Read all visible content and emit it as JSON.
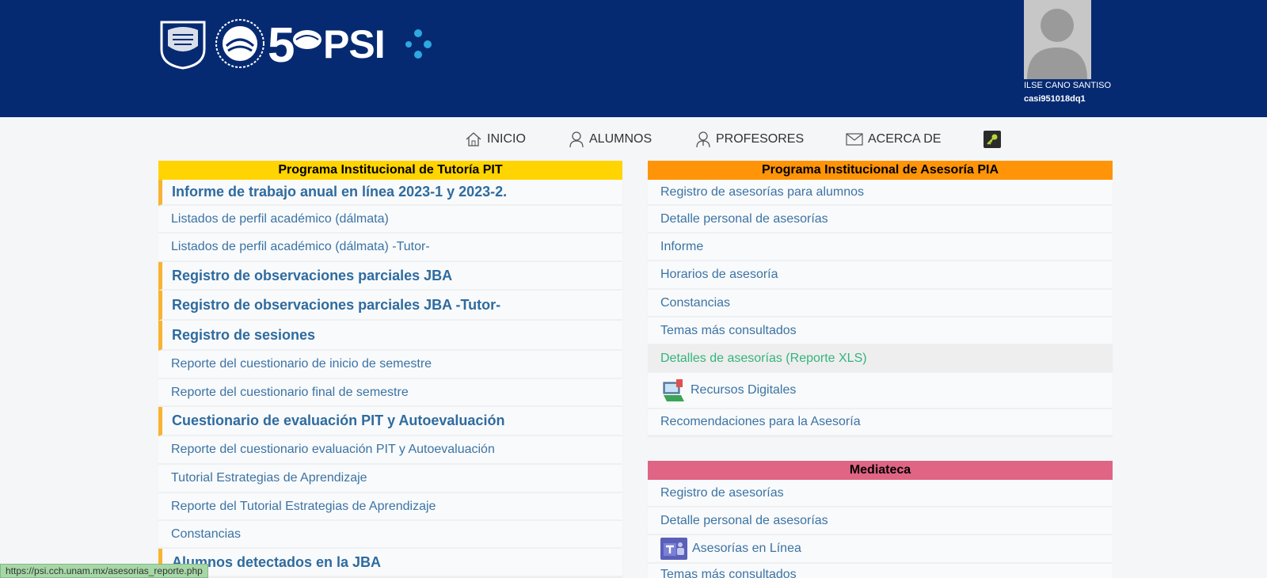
{
  "header": {
    "logo_text": "PSI",
    "user_name": "ILSE CANO SANTISO",
    "user_id": "casi951018dq1"
  },
  "nav": [
    {
      "label": "INICIO",
      "icon": "home-icon"
    },
    {
      "label": "ALUMNOS",
      "icon": "student-icon"
    },
    {
      "label": "PROFESORES",
      "icon": "teacher-icon"
    },
    {
      "label": "ACERCA DE",
      "icon": "envelope-icon"
    }
  ],
  "pit": {
    "title": "Programa Institucional de Tutoría PIT",
    "items": [
      "Informe de trabajo anual en línea 2023-1 y 2023-2.",
      "Listados de perfil académico (dálmata)",
      "Listados de perfil académico (dálmata) -Tutor-",
      "Registro de observaciones parciales JBA",
      "Registro de observaciones parciales JBA -Tutor-",
      "Registro de sesiones",
      "Reporte del cuestionario de inicio de semestre",
      "Reporte del cuestionario final de semestre",
      "Cuestionario de evaluación PIT y Autoevaluación",
      "Reporte del cuestionario evaluación PIT y Autoevaluación",
      "Tutorial Estrategias de Aprendizaje",
      "Reporte del Tutorial Estrategias de Aprendizaje",
      "Constancias",
      "Alumnos detectados en la JBA"
    ]
  },
  "pia": {
    "title": "Programa Institucional de Asesoría PIA",
    "items": [
      "Registro de asesorías para alumnos",
      "Detalle personal de asesorías",
      "Informe",
      "Horarios de asesoría",
      "Constancias",
      "Temas más consultados",
      "Detalles de asesorías (Reporte XLS)",
      "Recursos Digitales",
      "Recomendaciones para la Asesoría"
    ]
  },
  "mediateca": {
    "title": "Mediateca",
    "items": [
      "Registro de asesorías",
      "Detalle personal de asesorías",
      "Asesorías en Línea",
      "Temas más consultados"
    ]
  },
  "status_url": "https://psi.cch.unam.mx/asesorias_reporte.php",
  "colors": {
    "header_bg": "#062a72",
    "pit_head": "#ffd400",
    "pia_head": "#ff9408",
    "mediateca_head": "#e06483",
    "link": "#3b73a5",
    "accent_bar": "#f8b331"
  }
}
